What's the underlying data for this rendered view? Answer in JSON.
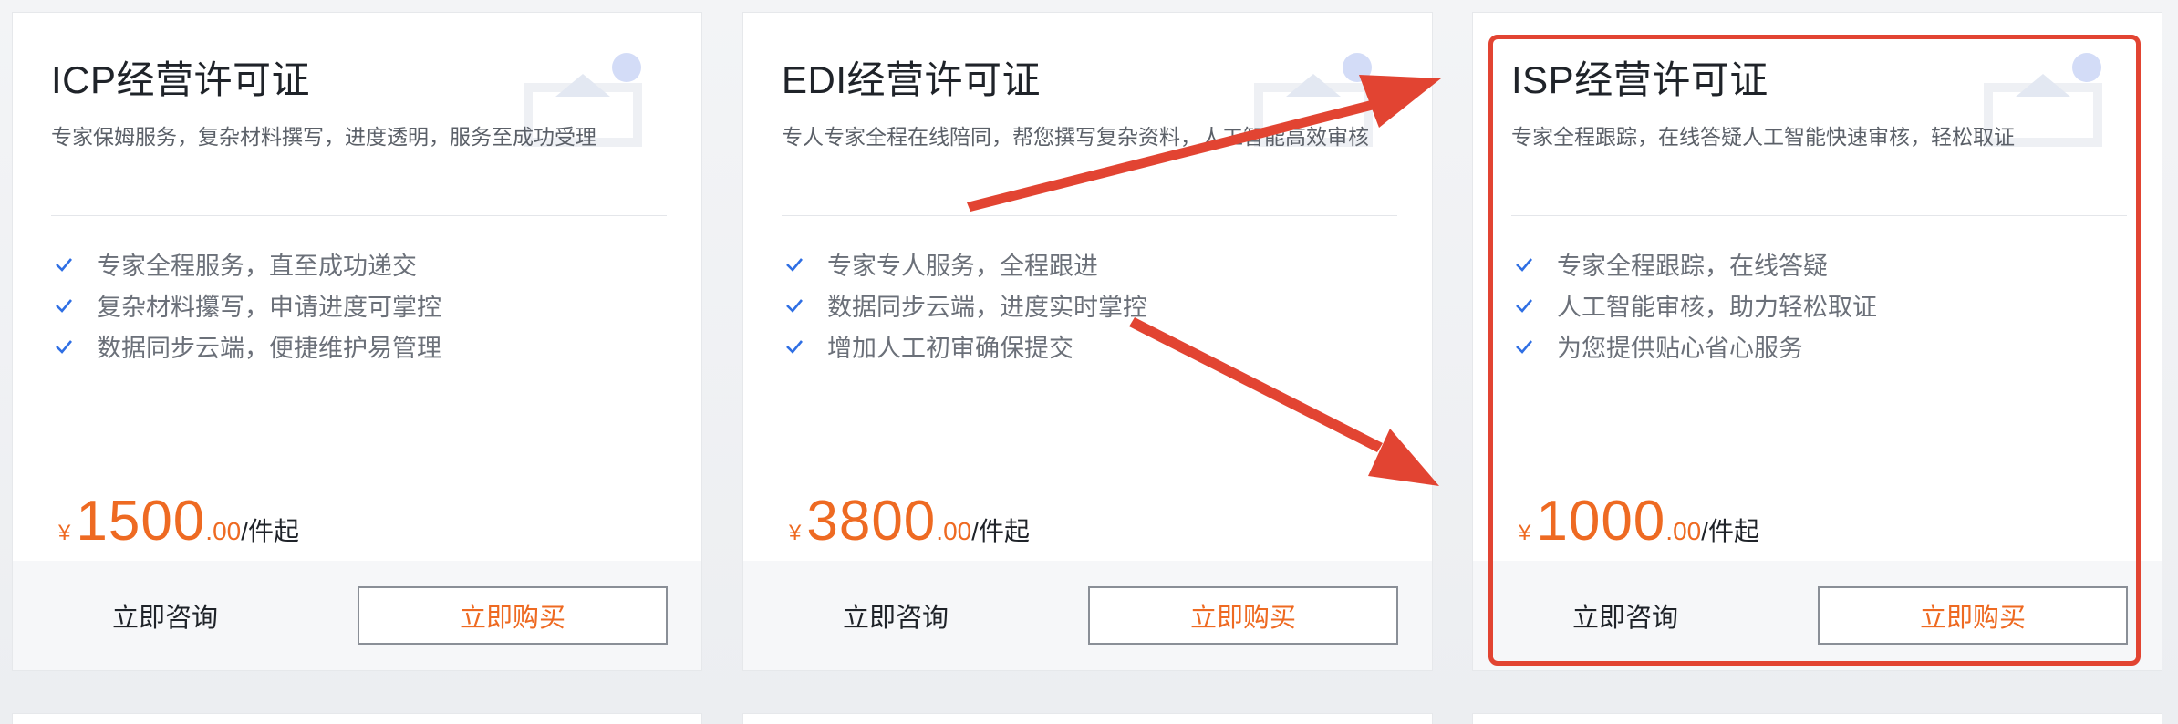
{
  "cards": [
    {
      "title": "ICP经营许可证",
      "description": "专家保姆服务，复杂材料撰写，进度透明，服务至成功受理",
      "features": [
        "专家全程服务，直至成功递交",
        "复杂材料攥写，申请进度可掌控",
        "数据同步云端，便捷维护易管理"
      ],
      "price": {
        "currency": "¥",
        "amount": "1500",
        "decimal": ".00",
        "unit": "/件起"
      },
      "consult_label": "立即咨询",
      "buy_label": "立即购买"
    },
    {
      "title": "EDI经营许可证",
      "description": "专人专家全程在线陪同，帮您撰写复杂资料，人工智能高效审核",
      "features": [
        "专家专人服务，全程跟进",
        "数据同步云端，进度实时掌控",
        "增加人工初审确保提交"
      ],
      "price": {
        "currency": "¥",
        "amount": "3800",
        "decimal": ".00",
        "unit": "/件起"
      },
      "consult_label": "立即咨询",
      "buy_label": "立即购买"
    },
    {
      "title": "ISP经营许可证",
      "description": "专家全程跟踪，在线答疑人工智能快速审核，轻松取证",
      "features": [
        "专家全程跟踪，在线答疑",
        "人工智能审核，助力轻松取证",
        "为您提供贴心省心服务"
      ],
      "price": {
        "currency": "¥",
        "amount": "1000",
        "decimal": ".00",
        "unit": "/件起"
      },
      "consult_label": "立即咨询",
      "buy_label": "立即购买"
    }
  ],
  "icons": {
    "feature_check": "check-icon",
    "card_decoration": "decoration-illustration"
  },
  "colors": {
    "accent_orange": "#ee6a22",
    "check_blue": "#2f6fe4",
    "annotation_red": "#e24432",
    "button_border": "#8a8f97"
  }
}
